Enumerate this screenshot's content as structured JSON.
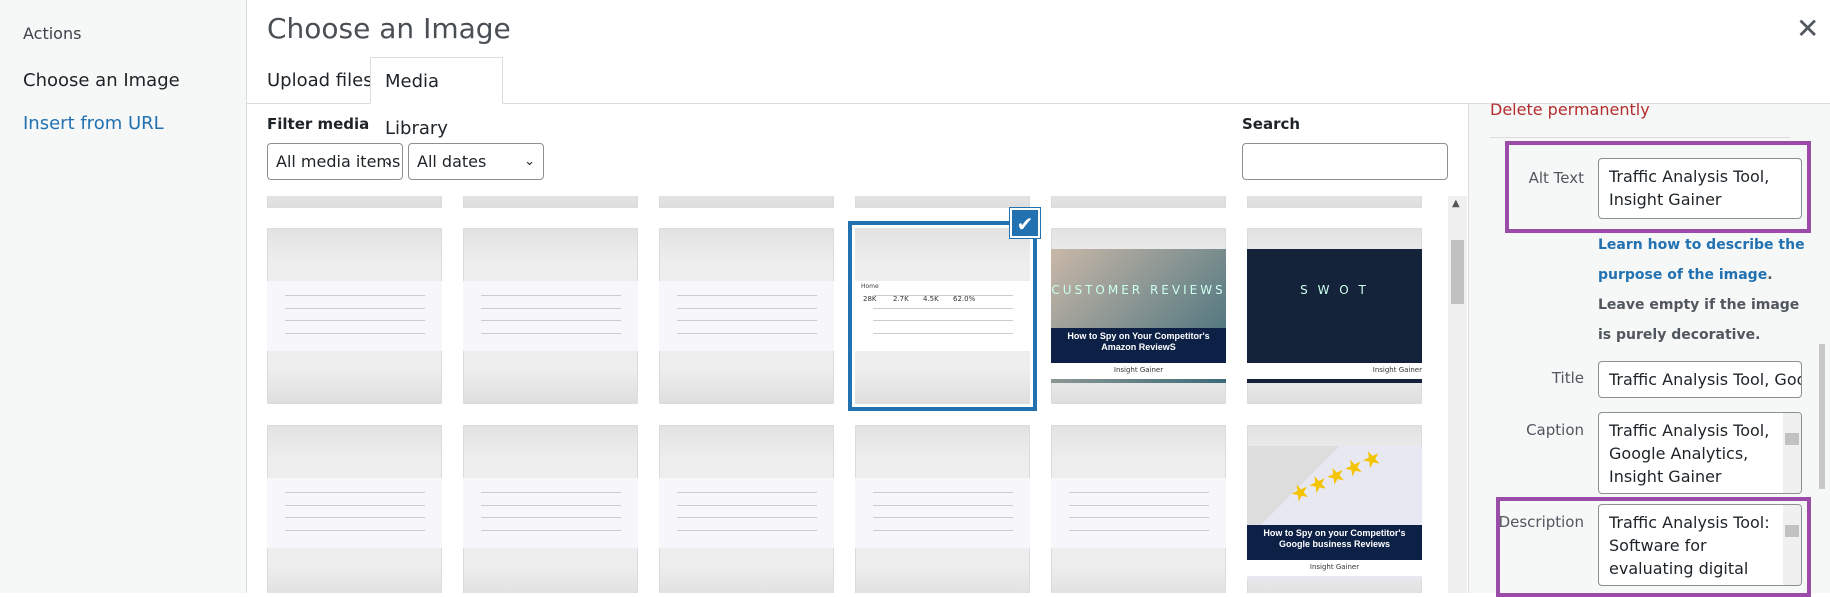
{
  "sidebar": {
    "heading": "Actions",
    "items": [
      {
        "label": "Choose an Image",
        "active": true
      },
      {
        "label": "Insert from URL",
        "active": false
      }
    ]
  },
  "modal": {
    "title": "Choose an Image",
    "close_icon": "close-icon"
  },
  "tabs": [
    {
      "label": "Upload files",
      "active": false
    },
    {
      "label": "Media Library",
      "active": true
    }
  ],
  "filters": {
    "label": "Filter media",
    "type_select": "All media items",
    "date_select": "All dates",
    "search_label": "Search",
    "search_value": ""
  },
  "grid": {
    "selected_index": 3,
    "items": [
      {
        "kind": "screenshot"
      },
      {
        "kind": "screenshot"
      },
      {
        "kind": "screenshot"
      },
      {
        "kind": "analytics",
        "heading": "Home",
        "stats": [
          "28K",
          "2.7K",
          "4.5K",
          "62.0%"
        ]
      },
      {
        "kind": "banner",
        "title": "How to Spy on Your Competitor's Amazon ReviewS",
        "overlay": "CUSTOMER REVIEWS",
        "brand": "Insight Gainer"
      },
      {
        "kind": "dark",
        "overlay": "S W O T",
        "brand": "Insight Gainer"
      },
      {
        "kind": "screenshot"
      },
      {
        "kind": "screenshot"
      },
      {
        "kind": "screenshot"
      },
      {
        "kind": "screenshot"
      },
      {
        "kind": "screenshot"
      },
      {
        "kind": "banner-light",
        "title": "How to Spy on your Competitor's Google business Reviews",
        "brand": "Insight Gainer"
      }
    ]
  },
  "details": {
    "delete_label": "Delete permanently",
    "alt_text": {
      "label": "Alt Text",
      "value": "Traffic Analysis Tool, Insight Gainer"
    },
    "hint": {
      "link": "Learn how to describe the purpose of the image",
      "rest": ". Leave empty if the image is purely decorative."
    },
    "title": {
      "label": "Title",
      "value": "Traffic Analysis Tool, Google Analytics, Insight Gainer"
    },
    "caption": {
      "label": "Caption",
      "value": "Traffic Analysis Tool, Google Analytics, Insight Gainer"
    },
    "description": {
      "label": "Description",
      "value": "Traffic Analysis Tool: Software for evaluating digital"
    }
  },
  "colors": {
    "accent": "#2271b1",
    "delete": "#b32d2e",
    "highlight": "#9b4ca8"
  }
}
